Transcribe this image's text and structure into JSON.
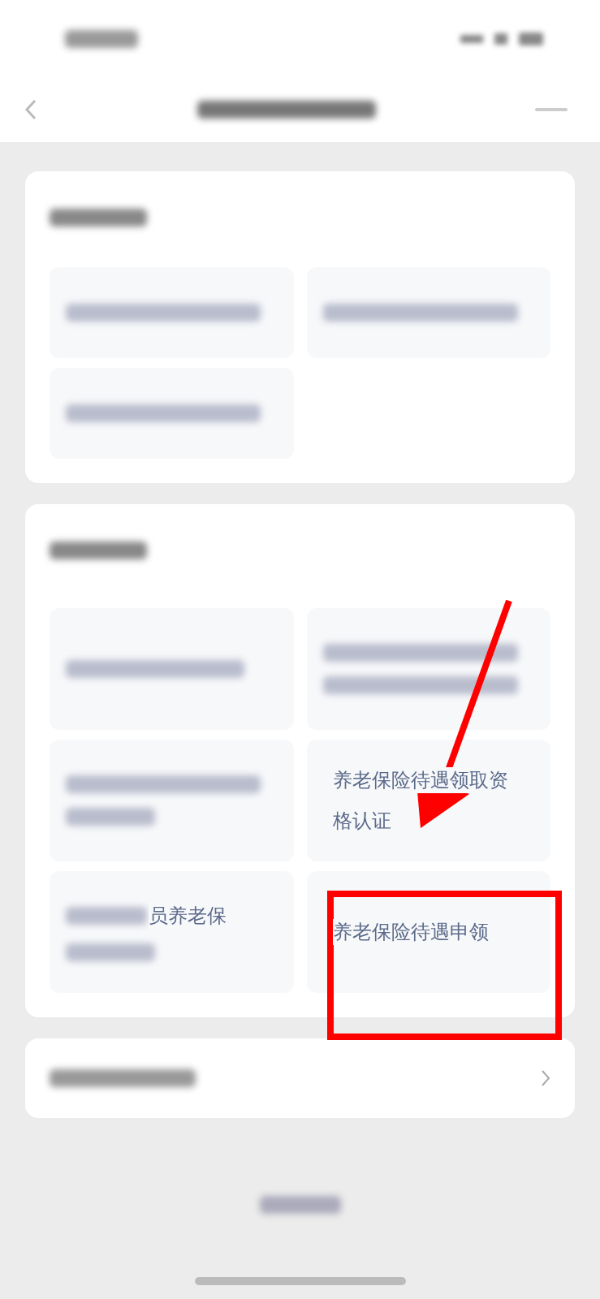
{
  "sections": [
    {
      "tiles": [
        {
          "kind": "blurred"
        },
        {
          "kind": "blurred"
        },
        {
          "kind": "blurred"
        }
      ]
    },
    {
      "tiles": [
        {
          "kind": "blurred"
        },
        {
          "kind": "blurred"
        },
        {
          "kind": "blurred"
        },
        {
          "kind": "text",
          "lines": [
            "养老保险待遇领取资",
            "格认证"
          ]
        },
        {
          "kind": "mixed",
          "lines": [
            "员养老保"
          ]
        },
        {
          "kind": "text",
          "lines": [
            "养老保险待遇申领"
          ]
        }
      ]
    }
  ]
}
